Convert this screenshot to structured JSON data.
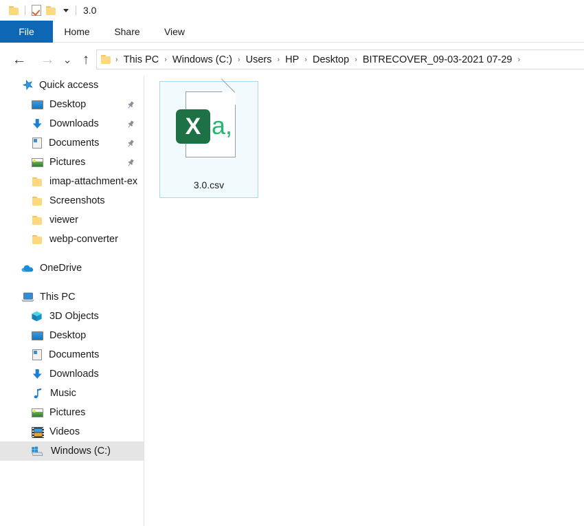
{
  "window": {
    "title": "3.0",
    "quick_access_toolbar": [
      {
        "name": "folder-icon",
        "label": ""
      },
      {
        "name": "properties-icon",
        "label": ""
      },
      {
        "name": "new-folder-icon",
        "label": ""
      },
      {
        "name": "customize-qat-caret",
        "label": ""
      }
    ]
  },
  "ribbon": {
    "tabs": [
      {
        "label": "File",
        "active": true
      },
      {
        "label": "Home",
        "active": false
      },
      {
        "label": "Share",
        "active": false
      },
      {
        "label": "View",
        "active": false
      }
    ]
  },
  "navigation": {
    "back_glyph": "←",
    "forward_glyph": "→",
    "recent_glyph": "⌄",
    "up_glyph": "↑",
    "breadcrumb": [
      "This PC",
      "Windows (C:)",
      "Users",
      "HP",
      "Desktop",
      "BITRECOVER_09-03-2021 07-29"
    ],
    "separator": "›"
  },
  "sidebar": {
    "groups": [
      {
        "header": "Quick access",
        "icon": "star-icon",
        "items": [
          {
            "label": "Desktop",
            "icon": "desktop-icon",
            "pinned": true,
            "selected": false
          },
          {
            "label": "Downloads",
            "icon": "download-icon",
            "pinned": true,
            "selected": false
          },
          {
            "label": "Documents",
            "icon": "documents-icon",
            "pinned": true,
            "selected": false
          },
          {
            "label": "Pictures",
            "icon": "pictures-icon",
            "pinned": true,
            "selected": false
          },
          {
            "label": "imap-attachment-ex",
            "icon": "folder-icon",
            "pinned": false,
            "selected": false
          },
          {
            "label": "Screenshots",
            "icon": "folder-icon",
            "pinned": false,
            "selected": false
          },
          {
            "label": "viewer",
            "icon": "folder-icon",
            "pinned": false,
            "selected": false
          },
          {
            "label": "webp-converter",
            "icon": "folder-icon",
            "pinned": false,
            "selected": false
          }
        ]
      },
      {
        "header": "OneDrive",
        "icon": "cloud-icon",
        "items": []
      },
      {
        "header": "This PC",
        "icon": "pc-icon",
        "items": [
          {
            "label": "3D Objects",
            "icon": "3d-objects-icon",
            "pinned": false,
            "selected": false
          },
          {
            "label": "Desktop",
            "icon": "desktop-icon",
            "pinned": false,
            "selected": false
          },
          {
            "label": "Documents",
            "icon": "documents-icon",
            "pinned": false,
            "selected": false
          },
          {
            "label": "Downloads",
            "icon": "download-icon",
            "pinned": false,
            "selected": false
          },
          {
            "label": "Music",
            "icon": "music-icon",
            "pinned": false,
            "selected": false
          },
          {
            "label": "Pictures",
            "icon": "pictures-icon",
            "pinned": false,
            "selected": false
          },
          {
            "label": "Videos",
            "icon": "videos-icon",
            "pinned": false,
            "selected": false
          },
          {
            "label": "Windows (C:)",
            "icon": "drive-icon",
            "pinned": false,
            "selected": true
          }
        ]
      }
    ]
  },
  "content": {
    "files": [
      {
        "name": "3.0.csv",
        "icon": "csv-excel-icon",
        "badge_letter": "X",
        "badge_glyph": "a,",
        "selected": true
      }
    ]
  },
  "colors": {
    "accent_blue": "#0d67b4",
    "excel_green": "#1e7145",
    "csv_a_green": "#27b573",
    "folder_yellow": "#fcd980",
    "selection_fill": "#f3fafd",
    "selection_border": "#a8d7f2",
    "nav_selected": "#e5e5e5"
  }
}
